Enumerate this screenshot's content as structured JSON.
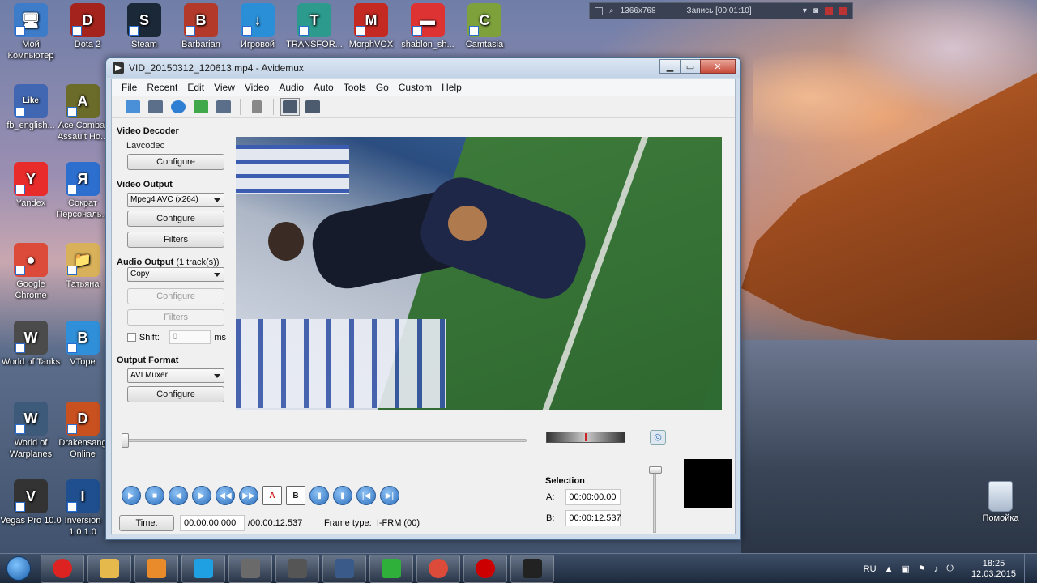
{
  "desktop": {
    "icons": [
      {
        "label": "Мой Компьютер",
        "color": "#3c7cc8",
        "glyph": "🖥"
      },
      {
        "label": "Dota 2",
        "color": "#a4231d",
        "glyph": "D"
      },
      {
        "label": "Steam",
        "color": "#1b2838",
        "glyph": "S"
      },
      {
        "label": "Barbarian",
        "color": "#b33a2a",
        "glyph": "B"
      },
      {
        "label": "Игровой",
        "color": "#2a8fd6",
        "glyph": "↓"
      },
      {
        "label": "TRANSFOR...",
        "color": "#2c9a8c",
        "glyph": "T"
      },
      {
        "label": "MorphVOX",
        "color": "#c42a22",
        "glyph": "M"
      },
      {
        "label": "shablon_sh...",
        "color": "#d33",
        "glyph": "▬"
      },
      {
        "label": "Camtasia",
        "color": "#7ea13b",
        "glyph": "C"
      },
      {
        "label": "fb_english...",
        "color": "#4267b2",
        "glyph": "Like"
      },
      {
        "label": "Ace Combat Assault Ho...",
        "color": "#6b6b2a",
        "glyph": "A"
      },
      {
        "label": "Yandex",
        "color": "#e82b2b",
        "glyph": "Y"
      },
      {
        "label": "Сократ Персональ...",
        "color": "#2d6fcf",
        "glyph": "Я"
      },
      {
        "label": "Google Chrome",
        "color": "#dc4a3a",
        "glyph": "●"
      },
      {
        "label": "Татьяна",
        "color": "#d9b15a",
        "glyph": "📁"
      },
      {
        "label": "World of Tanks",
        "color": "#4b4b4b",
        "glyph": "W"
      },
      {
        "label": "VTope",
        "color": "#2f8fd8",
        "glyph": "B"
      },
      {
        "label": "World of Warplanes",
        "color": "#3d5a7a",
        "glyph": "W"
      },
      {
        "label": "Drakensang Online",
        "color": "#c9501f",
        "glyph": "D"
      },
      {
        "label": "Vegas Pro 10.0",
        "color": "#333",
        "glyph": "V"
      },
      {
        "label": "Inversion 1.0.1.0",
        "color": "#1f4f8f",
        "glyph": "I"
      }
    ],
    "trash_label": "Помойка"
  },
  "recorder": {
    "resolution": "1366x768",
    "status": "Запись [00:01:10]"
  },
  "window": {
    "title": "VID_20150312_120613.mp4 - Avidemux",
    "menu": [
      "File",
      "Recent",
      "Edit",
      "View",
      "Video",
      "Audio",
      "Auto",
      "Tools",
      "Go",
      "Custom",
      "Help"
    ]
  },
  "left_panel": {
    "video_decoder": {
      "title": "Video Decoder",
      "codec": "Lavcodec",
      "configure": "Configure"
    },
    "video_output": {
      "title": "Video Output",
      "selected": "Mpeg4 AVC (x264)",
      "configure": "Configure",
      "filters": "Filters"
    },
    "audio_output": {
      "title": "Audio Output",
      "tracks": "(1 track(s))",
      "selected": "Copy",
      "configure": "Configure",
      "filters": "Filters",
      "shift_label": "Shift:",
      "shift_value": "0",
      "shift_unit": "ms"
    },
    "output_format": {
      "title": "Output Format",
      "selected": "AVI Muxer",
      "configure": "Configure"
    }
  },
  "status": {
    "time_button": "Time:",
    "current_time": "00:00:00.000",
    "total_time": "/00:00:12.537",
    "frame_type_label": "Frame type:",
    "frame_type": "I-FRM (00)"
  },
  "selection": {
    "title": "Selection",
    "a_label": "A:",
    "a_value": "00:00:00.00",
    "b_label": "B:",
    "b_value": "00:00:12.537"
  },
  "playback": {
    "position_fraction": 0.0
  },
  "taskbar": {
    "lang": "RU",
    "time": "18:25",
    "date": "12.03.2015",
    "apps": [
      {
        "name": "opera",
        "color": "#d22"
      },
      {
        "name": "explorer",
        "color": "#e5b94b"
      },
      {
        "name": "media-player",
        "color": "#e98b2a"
      },
      {
        "name": "skype",
        "color": "#1fa0e3"
      },
      {
        "name": "game",
        "color": "#6a6a6a"
      },
      {
        "name": "world-of-tanks",
        "color": "#555"
      },
      {
        "name": "warplanes",
        "color": "#3a5a8a"
      },
      {
        "name": "star-app",
        "color": "#2fb03a"
      },
      {
        "name": "chrome",
        "color": "#dc4a3a"
      },
      {
        "name": "recorder",
        "color": "#c00"
      },
      {
        "name": "avidemux",
        "color": "#222"
      }
    ]
  }
}
